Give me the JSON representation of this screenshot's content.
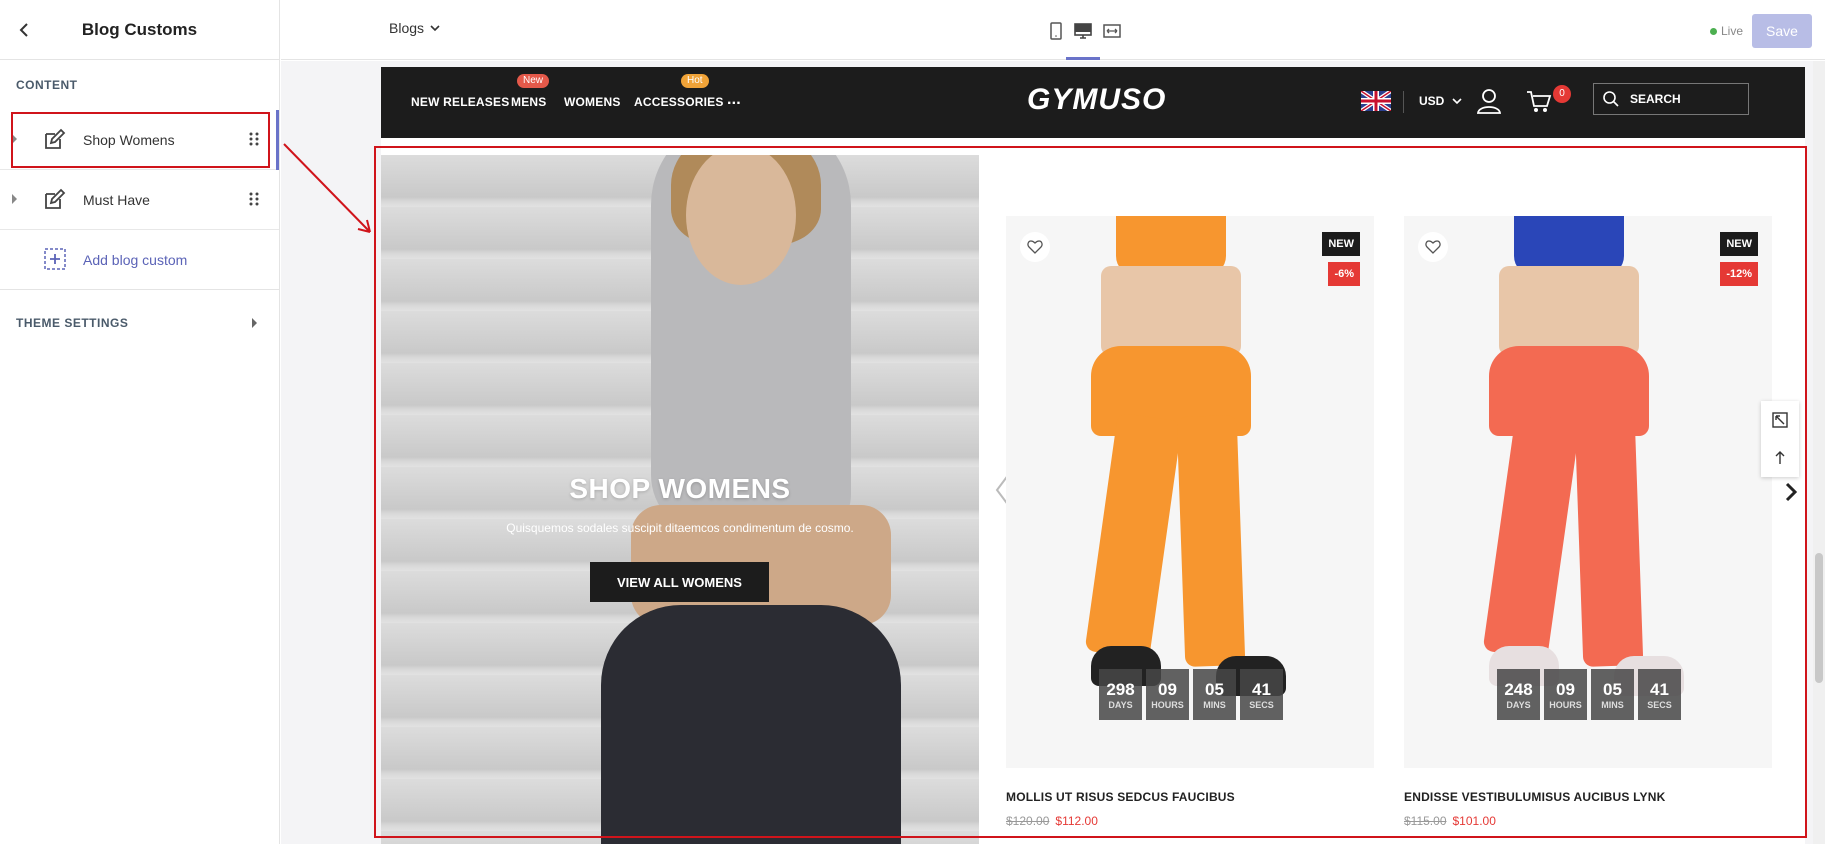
{
  "sidebar": {
    "title": "Blog Customs",
    "content_label": "CONTENT",
    "items": [
      {
        "label": "Shop Womens",
        "icon": "edit-icon"
      },
      {
        "label": "Must Have",
        "icon": "edit-icon"
      }
    ],
    "add_label": "Add blog custom",
    "theme_settings_label": "THEME SETTINGS"
  },
  "topbar": {
    "page_selector": "Blogs",
    "live_label": "Live",
    "save_label": "Save"
  },
  "store": {
    "nav": {
      "items": [
        {
          "label": "NEW RELEASES",
          "badge": ""
        },
        {
          "label": "MENS",
          "badge": "New"
        },
        {
          "label": "WOMENS",
          "badge": ""
        },
        {
          "label": "ACCESSORIES",
          "badge": "Hot"
        },
        {
          "label": "...",
          "badge": ""
        }
      ],
      "logo": "GYMUSO",
      "currency": "USD",
      "cart_count": "0",
      "search_placeholder": "SEARCH"
    },
    "banner": {
      "title": "SHOP WOMENS",
      "subtitle": "Quisquemos sodales suscipit ditaemcos condimentum de cosmo.",
      "button_label": "VIEW ALL WOMENS"
    },
    "products": [
      {
        "name": "MOLLIS UT RISUS SEDCUS FAUCIBUS",
        "price_old": "$120.00",
        "price_new": "$112.00",
        "badge_new": "NEW",
        "badge_sale": "-6%",
        "countdown": [
          {
            "value": "298",
            "label": "DAYS"
          },
          {
            "value": "09",
            "label": "HOURS"
          },
          {
            "value": "05",
            "label": "MINS"
          },
          {
            "value": "41",
            "label": "SECS"
          }
        ]
      },
      {
        "name": "ENDISSE VESTIBULUMISUS AUCIBUS LYNK",
        "price_old": "$115.00",
        "price_new": "$101.00",
        "badge_new": "NEW",
        "badge_sale": "-12%",
        "countdown": [
          {
            "value": "248",
            "label": "DAYS"
          },
          {
            "value": "09",
            "label": "HOURS"
          },
          {
            "value": "05",
            "label": "MINS"
          },
          {
            "value": "41",
            "label": "SECS"
          }
        ]
      }
    ]
  },
  "colors": {
    "accent": "#6a73c9",
    "highlight": "#d0141b",
    "nav_bg": "#1c1c1c",
    "sale": "#e53935",
    "product1_color": "#f7962f",
    "product2_color": "#f36a52"
  }
}
